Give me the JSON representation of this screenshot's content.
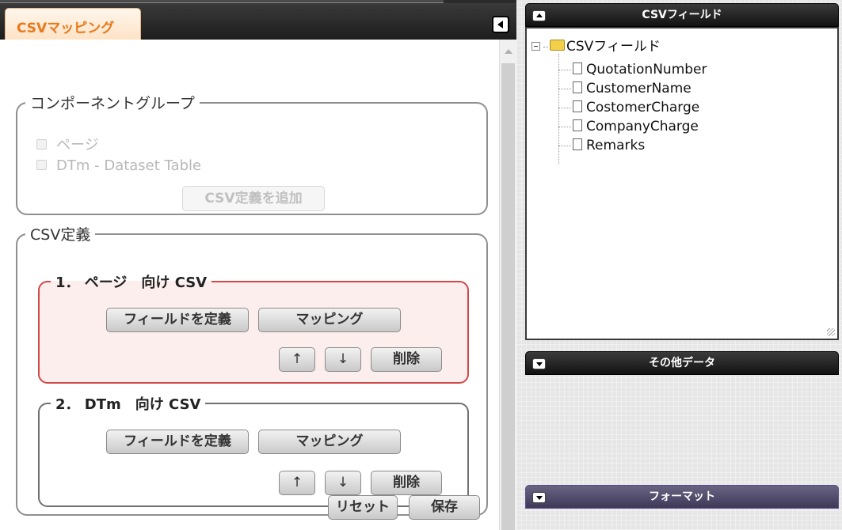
{
  "left": {
    "tab_label": "CSVマッピング",
    "component_group": {
      "legend": "コンポーネントグループ",
      "checkboxes": [
        {
          "label": "ページ",
          "checked": false,
          "disabled": true
        },
        {
          "label": "DTm - Dataset Table",
          "checked": false,
          "disabled": true
        }
      ],
      "add_button": "CSV定義を追加"
    },
    "csv_definition": {
      "legend": "CSV定義",
      "items": [
        {
          "title": "1． ページ　向け CSV",
          "define_fields": "フィールドを定義",
          "mapping": "マッピング",
          "up": "↑",
          "down": "↓",
          "delete": "削除"
        },
        {
          "title": "2． DTm　向け CSV",
          "define_fields": "フィールドを定義",
          "mapping": "マッピング",
          "up": "↑",
          "down": "↓",
          "delete": "削除"
        }
      ]
    },
    "footer": {
      "reset": "リセット",
      "save": "保存"
    }
  },
  "right": {
    "csv_field_panel": {
      "title": "CSVフィールド",
      "tree_root": "CSVフィールド",
      "fields": [
        "QuotationNumber",
        "CustomerName",
        "CostomerCharge",
        "CompanyCharge",
        "Remarks"
      ]
    },
    "other_data_panel": {
      "title": "その他データ"
    },
    "format_panel": {
      "title": "フォーマット"
    }
  },
  "colors": {
    "tab_text": "#e8781a",
    "selected_item_border": "#d04848",
    "selected_item_bg": "#fdeeee",
    "format_header": "#4f4a6b"
  }
}
